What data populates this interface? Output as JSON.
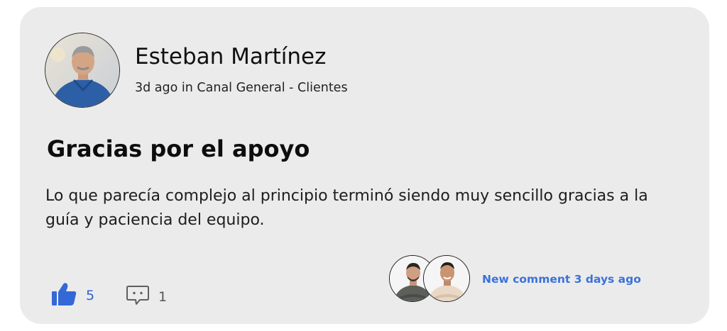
{
  "post": {
    "author": {
      "name": "Esteban Martínez",
      "avatar": "author-avatar-photo"
    },
    "meta": "3d ago in Canal General - Clientes",
    "title": "Gracias por el apoyo",
    "body": "Lo que parecía complejo al principio terminó siendo muy sencillo gracias a la guía y paciencia del equipo."
  },
  "footer": {
    "likes": {
      "icon": "thumbs-up-icon",
      "count": "5",
      "color": "#2f63d0"
    },
    "comments": {
      "icon": "comment-bubble-icon",
      "count": "1"
    },
    "recent_commenters": [
      "commenter-avatar-1",
      "commenter-avatar-2"
    ],
    "new_comment_text": "New comment 3 days ago",
    "new_comment_color": "#3b72d8"
  },
  "colors": {
    "card_background": "#ebebec",
    "accent": "#2f63d0"
  }
}
